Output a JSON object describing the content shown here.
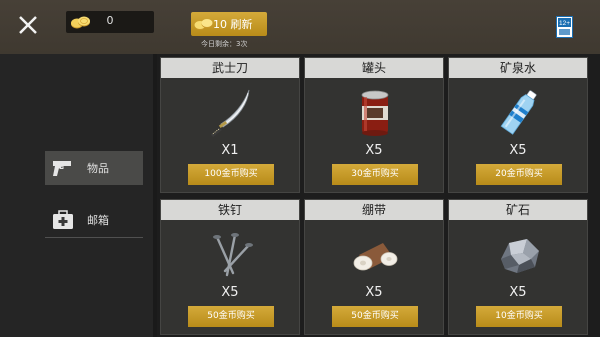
{
  "header": {
    "coin_count": "0",
    "refresh_label": "10 刷新",
    "refresh_remaining": "今日剩余：3次",
    "age_badge_text": "12+"
  },
  "sidebar": {
    "items": [
      {
        "label": "物品",
        "icon": "pistol-icon",
        "selected": true
      },
      {
        "label": "邮箱",
        "icon": "medkit-icon",
        "selected": false
      }
    ]
  },
  "shop": {
    "items": [
      {
        "name": "武士刀",
        "qty": "X1",
        "price": "100金币购买",
        "icon": "katana-icon"
      },
      {
        "name": "罐头",
        "qty": "X5",
        "price": "30金币购买",
        "icon": "canned-food-icon"
      },
      {
        "name": "矿泉水",
        "qty": "X5",
        "price": "20金币购买",
        "icon": "water-bottle-icon"
      },
      {
        "name": "铁钉",
        "qty": "X5",
        "price": "50金币购买",
        "icon": "nails-icon"
      },
      {
        "name": "绷带",
        "qty": "X5",
        "price": "50金币购买",
        "icon": "bandage-icon"
      },
      {
        "name": "矿石",
        "qty": "X5",
        "price": "10金币购买",
        "icon": "ore-icon"
      }
    ]
  },
  "colors": {
    "accent_gold": "#c89b26",
    "topbar": "#443d33",
    "card_title_bg": "#d8d8d6"
  }
}
